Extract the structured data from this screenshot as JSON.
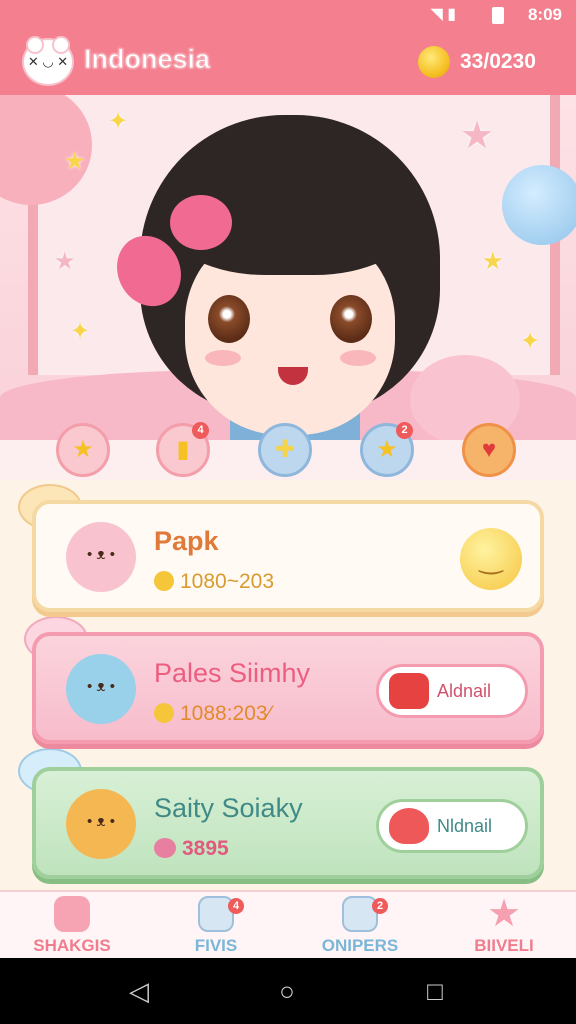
{
  "status_bar": {
    "time": "8:09"
  },
  "header": {
    "title": "Indonesia",
    "coins": "33/0230"
  },
  "quick_row": {
    "items": [
      {
        "icon": "star-icon",
        "badge": ""
      },
      {
        "icon": "cup-icon",
        "badge": "4"
      },
      {
        "icon": "puzzle-icon",
        "badge": ""
      },
      {
        "icon": "star-icon",
        "badge": "2"
      },
      {
        "icon": "heart-icon",
        "badge": ""
      }
    ]
  },
  "cards": [
    {
      "name": "Papk",
      "score": "1080~203",
      "action": ""
    },
    {
      "name": "Pales Siimhy",
      "score": "1088:203⁄",
      "action": "Aldnail"
    },
    {
      "name": "Saity Soiaky",
      "score": "3895",
      "action": "Nldnail"
    }
  ],
  "bottom_nav": {
    "items": [
      {
        "label": "SHAKGIS",
        "badge": "",
        "color": "#f07c8e"
      },
      {
        "label": "FIVIS",
        "badge": "4",
        "color": "#7ab6d8"
      },
      {
        "label": "ONIPERS",
        "badge": "2",
        "color": "#7ab6d8"
      },
      {
        "label": "BIIVELI",
        "badge": "",
        "color": "#f07c8e"
      }
    ]
  },
  "colors": {
    "accent": "#f47f8e",
    "gold": "#f5c125"
  }
}
